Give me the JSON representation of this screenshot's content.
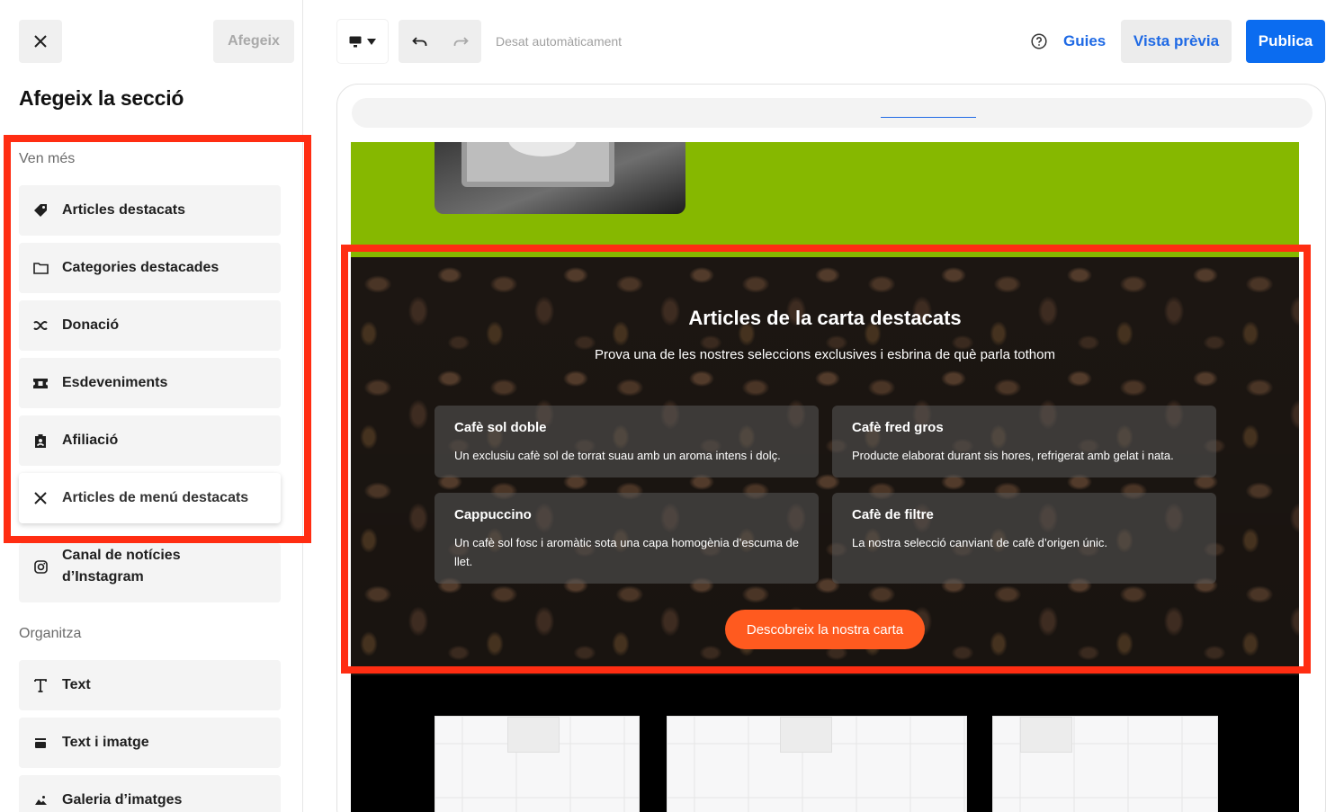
{
  "panel": {
    "add_label": "Afegeix",
    "title": "Afegeix la secció",
    "group_sell": "Ven més",
    "group_organize": "Organitza",
    "items": {
      "featured_items": "Articles destacats",
      "featured_categories": "Categories destacades",
      "donation": "Donació",
      "events": "Esdeveniments",
      "membership": "Afiliació",
      "featured_menu_items": "Articles de menú destacats",
      "instagram_feed": "Canal de notícies d’Instagram",
      "text": "Text",
      "text_image": "Text i imatge",
      "image_gallery": "Galeria d’imatges"
    }
  },
  "toolbar": {
    "autosave": "Desat automàticament",
    "guides": "Guies",
    "preview": "Vista prèvia",
    "publish": "Publica"
  },
  "section": {
    "title": "Articles de la carta destacats",
    "subtitle": "Prova una de les nostres seleccions exclusives i esbrina de què parla tothom",
    "cards": [
      {
        "name": "Cafè sol doble",
        "desc": "Un exclusiu cafè sol de torrat suau amb un aroma intens i dolç."
      },
      {
        "name": "Cafè fred gros",
        "desc": "Producte elaborat durant sis hores, refrigerat amb gelat i nata."
      },
      {
        "name": "Cappuccino",
        "desc": "Un cafè sol fosc i aromàtic sota una capa homogènia d’escuma de llet."
      },
      {
        "name": "Cafè de filtre",
        "desc": "La nostra selecció canviant de cafè d’origen únic."
      }
    ],
    "cta": "Descobreix la nostra carta"
  },
  "colors": {
    "highlight": "#ff2d12",
    "accent_blue": "#0b6cf0",
    "link_blue": "#1f6ae5",
    "cta_orange": "#ff5a1f",
    "band_green": "#86b800"
  },
  "icons": {
    "close": "close-icon",
    "tag": "tag-icon",
    "folder": "folder-icon",
    "donation": "donation-icon",
    "ticket": "ticket-icon",
    "badge": "badge-icon",
    "menu": "cutlery-icon",
    "instagram": "instagram-icon",
    "text": "text-icon",
    "text_image": "text-image-icon",
    "gallery": "gallery-icon",
    "desktop": "desktop-icon",
    "undo": "undo-icon",
    "redo": "redo-icon",
    "help": "help-icon"
  }
}
